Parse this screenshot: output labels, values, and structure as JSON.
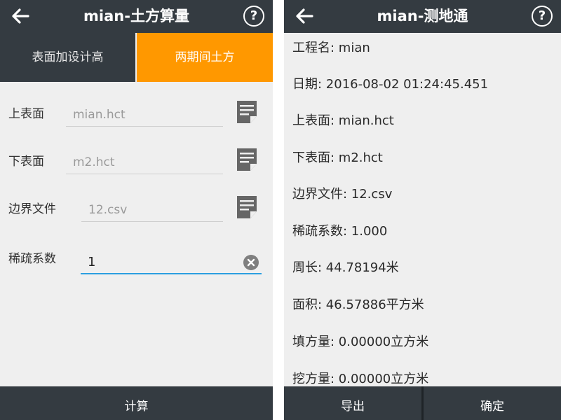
{
  "left": {
    "title": "mian-土方算量",
    "help": "?",
    "tabs": {
      "a": "表面加设计高",
      "b": "两期间土方"
    },
    "fields": {
      "upper_label": "上表面",
      "upper_value": "mian.hct",
      "lower_label": "下表面",
      "lower_value": "m2.hct",
      "boundary_label": "边界文件",
      "boundary_value": "12.csv",
      "sparse_label": "稀疏系数",
      "sparse_value": "1"
    },
    "calc_button": "计算"
  },
  "right": {
    "title": "mian-测地通",
    "help": "?",
    "info": [
      {
        "label": "工程名",
        "value": "mian"
      },
      {
        "label": "日期",
        "value": "2016-08-02 01:24:45.451"
      },
      {
        "label": "上表面",
        "value": "mian.hct"
      },
      {
        "label": "下表面",
        "value": "m2.hct"
      },
      {
        "label": "边界文件",
        "value": "12.csv"
      },
      {
        "label": "稀疏系数",
        "value": "1.000"
      },
      {
        "label": "周长",
        "value": "44.78194米"
      },
      {
        "label": "面积",
        "value": "46.57886平方米"
      },
      {
        "label": "填方量",
        "value": "0.00000立方米"
      },
      {
        "label": "挖方量",
        "value": "0.00000立方米"
      }
    ],
    "export_button": "导出",
    "ok_button": "确定"
  },
  "colors": {
    "appbar": "#343b41",
    "accent_tab": "#ff9800",
    "input_focus": "#2b9fe0",
    "background": "#efefef"
  },
  "icons": {
    "back": "arrow-left-icon",
    "help": "help-circle-icon",
    "file": "file-document-icon",
    "clear": "clear-circle-icon"
  }
}
